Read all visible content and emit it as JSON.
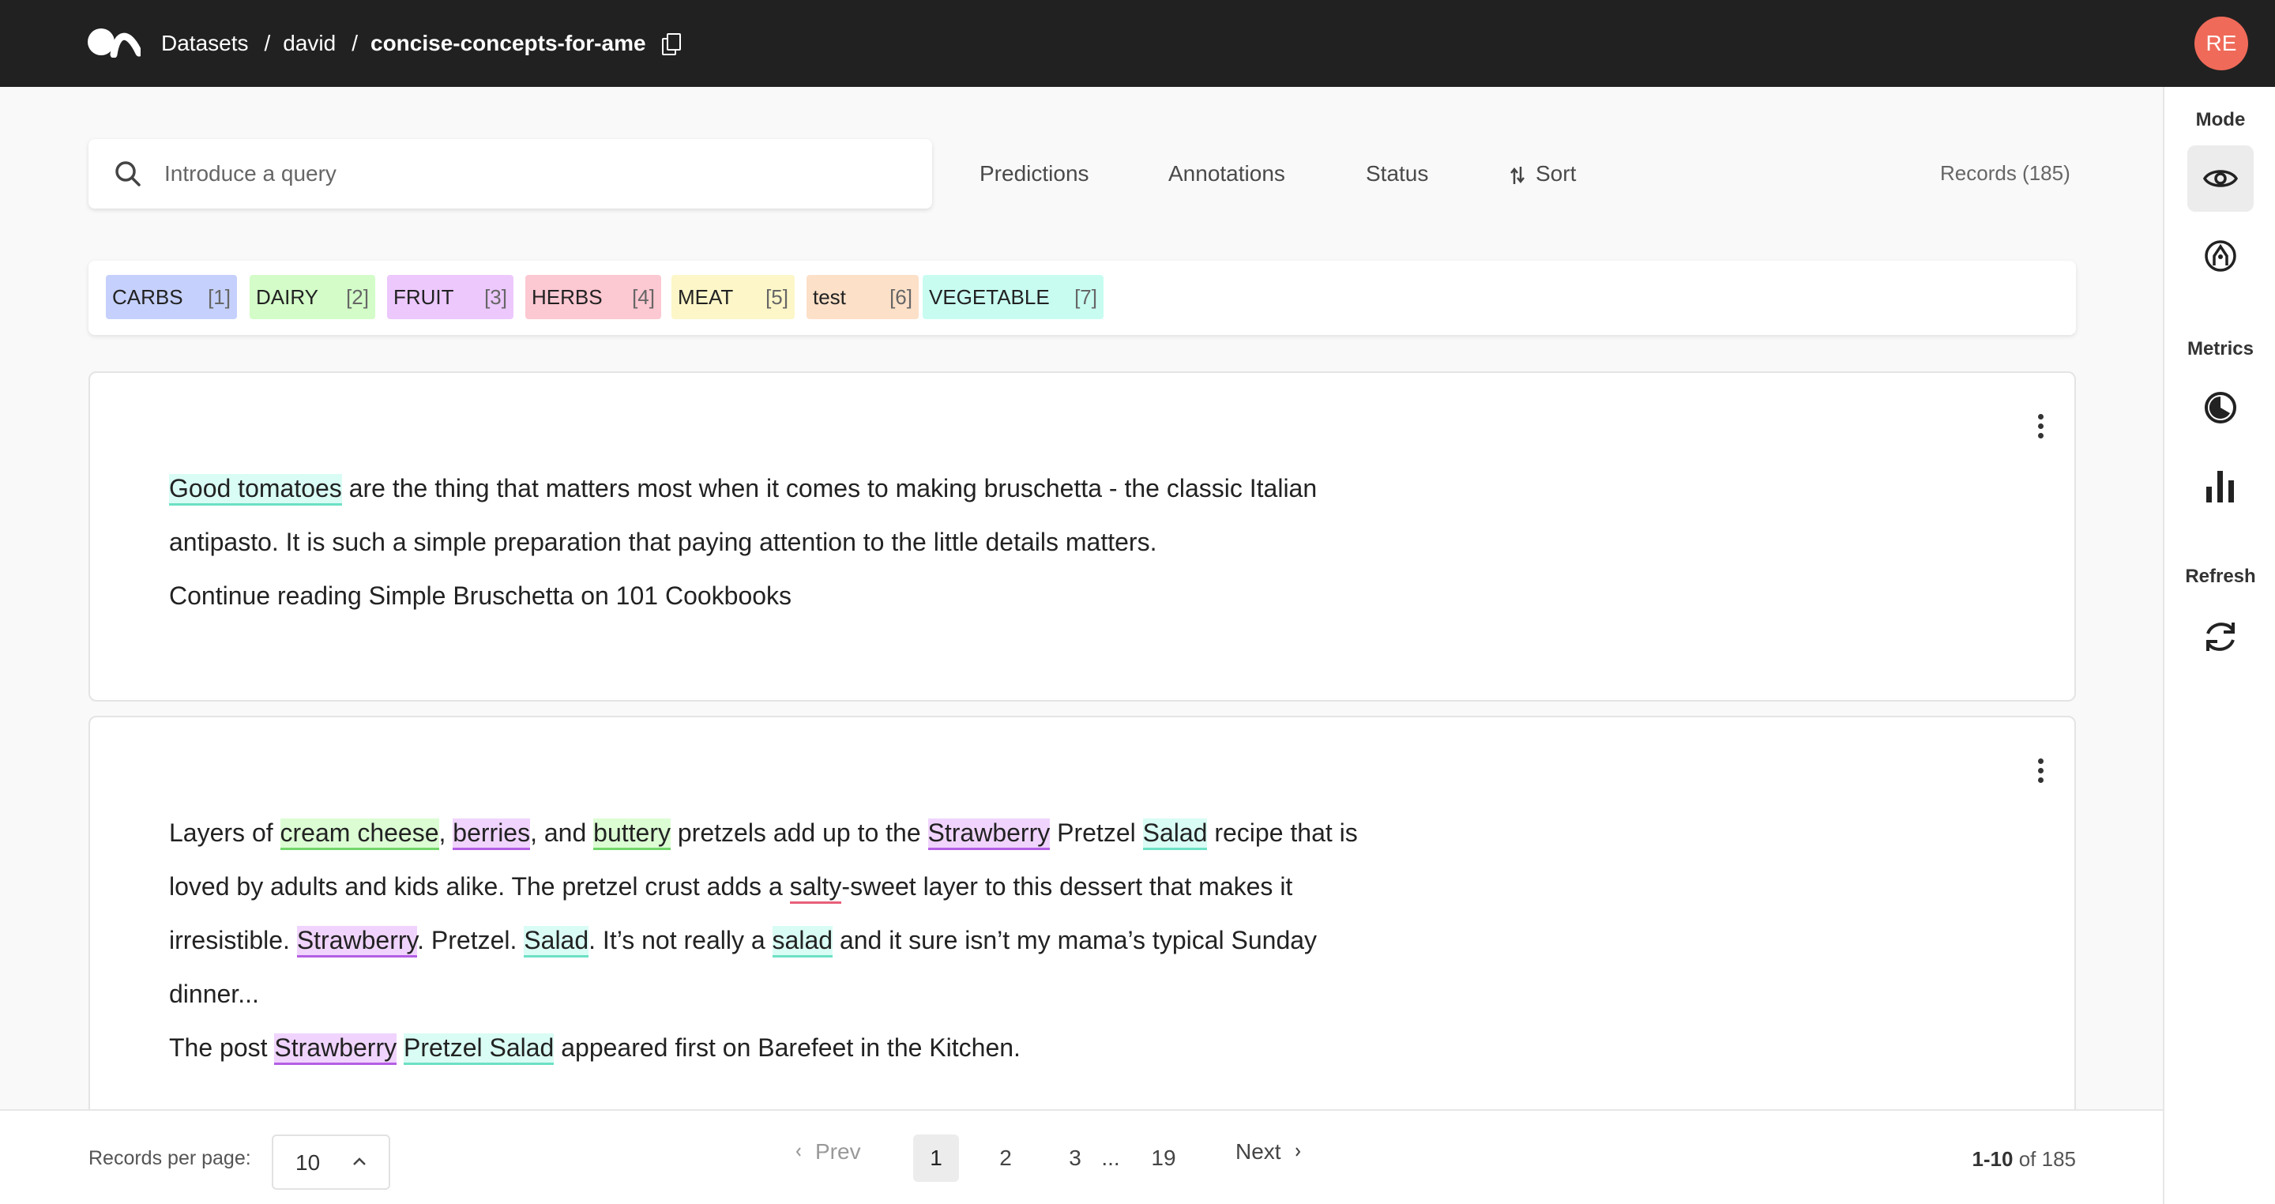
{
  "breadcrumbs": {
    "datasets": "Datasets",
    "owner": "david",
    "dataset": "concise-concepts-for-ame"
  },
  "user": {
    "initials": "RE"
  },
  "sidebar": {
    "mode_title": "Mode",
    "metrics_title": "Metrics",
    "refresh_title": "Refresh"
  },
  "search": {
    "placeholder": "Introduce a query",
    "value": ""
  },
  "filters": {
    "predictions": "Predictions",
    "annotations": "Annotations",
    "status": "Status",
    "sort": "Sort"
  },
  "records_count": "Records (185)",
  "labels": [
    {
      "name": "CARBS",
      "key": "[1]",
      "color": "#c5d0fc"
    },
    {
      "name": "DAIRY",
      "key": "[2]",
      "color": "#d3fcc8"
    },
    {
      "name": "FRUIT",
      "key": "[3]",
      "color": "#ecc8fc"
    },
    {
      "name": "HERBS",
      "key": "[4]",
      "color": "#fcc8d1"
    },
    {
      "name": "MEAT",
      "key": "[5]",
      "color": "#fcf6c8"
    },
    {
      "name": "test",
      "key": "[6]",
      "color": "#fce0c8"
    },
    {
      "name": "VEGETABLE",
      "key": "[7]",
      "color": "#c8fcf1"
    }
  ],
  "records": [
    {
      "lines": [
        [
          {
            "t": "Good tomatoes",
            "e": "veg"
          },
          {
            "t": " are the thing that matters most when it comes to making bruschetta - the classic Italian"
          }
        ],
        [
          {
            "t": "antipasto. It is such a simple preparation that paying attention to the little details matters."
          }
        ],
        [
          {
            "t": "Continue reading Simple Bruschetta on 101 Cookbooks"
          }
        ]
      ]
    },
    {
      "lines": [
        [
          {
            "t": "Layers of "
          },
          {
            "t": "cream cheese",
            "e": "dairy"
          },
          {
            "t": ", "
          },
          {
            "t": "berries",
            "e": "fruit"
          },
          {
            "t": ", and "
          },
          {
            "t": "buttery",
            "e": "dairy"
          },
          {
            "t": " pretzels add up to the "
          },
          {
            "t": "Strawberry",
            "e": "fruit"
          },
          {
            "t": " Pretzel "
          },
          {
            "t": "Salad",
            "e": "veg"
          },
          {
            "t": " recipe that is"
          }
        ],
        [
          {
            "t": "loved by adults and kids alike. The pretzel crust adds a "
          },
          {
            "t": "salty",
            "e": "herbs"
          },
          {
            "t": "-sweet layer to this dessert that makes it"
          }
        ],
        [
          {
            "t": "irresistible. "
          },
          {
            "t": "Strawberry",
            "e": "fruit"
          },
          {
            "t": ". Pretzel. "
          },
          {
            "t": "Salad",
            "e": "veg"
          },
          {
            "t": ". It’s not really a "
          },
          {
            "t": "salad",
            "e": "veg"
          },
          {
            "t": " and it sure isn’t my mama’s typical Sunday"
          }
        ],
        [
          {
            "t": "dinner..."
          }
        ],
        [
          {
            "t": "The post "
          },
          {
            "t": "Strawberry",
            "e": "fruit"
          },
          {
            "t": " "
          },
          {
            "t": "Pretzel Salad",
            "e": "veg"
          },
          {
            "t": " appeared first on Barefeet in the Kitchen."
          }
        ]
      ]
    }
  ],
  "footer": {
    "rpp_label": "Records per page:",
    "rpp_value": "10",
    "prev": "Prev",
    "next": "Next",
    "pages": [
      "1",
      "2",
      "3",
      "...",
      "19"
    ],
    "current_page": "1",
    "range_bold": "1-10",
    "range_rest": " of 185"
  }
}
